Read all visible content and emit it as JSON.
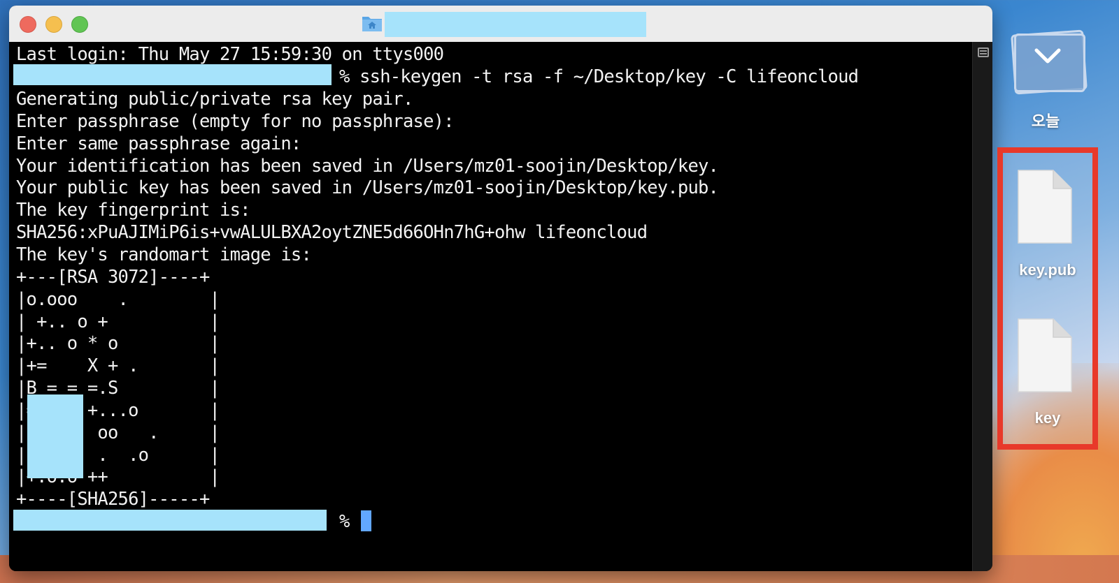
{
  "terminal": {
    "lines": [
      "Last login: Thu May 27 15:59:30 on ttys000",
      "% ssh-keygen -t rsa -f ~/Desktop/key -C lifeoncloud",
      "Generating public/private rsa key pair.",
      "Enter passphrase (empty for no passphrase):",
      "Enter same passphrase again:",
      "Your identification has been saved in /Users/mz01-soojin/Desktop/key.",
      "Your public key has been saved in /Users/mz01-soojin/Desktop/key.pub.",
      "The key fingerprint is:",
      "SHA256:xPuAJIMiP6is+vwALULBXA2oytZNE5d66OHn7hG+ohw lifeoncloud",
      "The key's randomart image is:",
      "+---[RSA 3072]----+",
      "|o.ooo    .        |",
      "| +.. o +          |",
      "|+.. o * o         |",
      "|+=    X + .       |",
      "|B = = =.S         |",
      "|=     +...o       |",
      "|o      oo   .     |",
      "|       .  .o      |",
      "|+.o.o ++          |",
      "+----[SHA256]-----+",
      "%"
    ]
  },
  "desktop": {
    "stack_label": "오늘",
    "files": [
      {
        "name": "key.pub"
      },
      {
        "name": "key"
      }
    ]
  }
}
